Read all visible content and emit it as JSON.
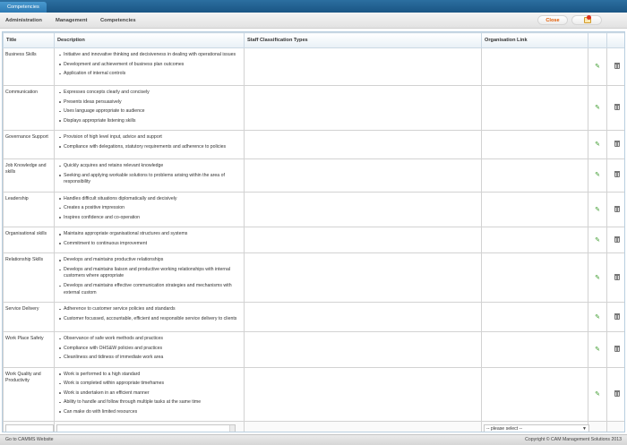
{
  "window": {
    "tab_label": "Competencies"
  },
  "menu": {
    "items": [
      "Administration",
      "Management",
      "Competencies"
    ],
    "close_label": "Close",
    "add_icon": "add-folder-icon"
  },
  "table": {
    "headers": [
      "Title",
      "Description",
      "Staff Classification Types",
      "Organisation Link"
    ],
    "rows": [
      {
        "title": "Business Skills",
        "items": [
          "Initiative and innovative thinking and decisiveness in dealing with operational issues",
          "Development and achievement of business plan outcomes",
          "Application of internal controls"
        ]
      },
      {
        "title": "Communication",
        "items": [
          "Expresses concepts clearly and concisely",
          "Presents ideas persuasively",
          "Uses language appropriate to audience",
          "Displays appropriate listening skills"
        ]
      },
      {
        "title": "Governance Support",
        "items": [
          "Provision of high level input, advice and support",
          "Compliance with delegations, statutory requirements and adherence to policies"
        ]
      },
      {
        "title": "Job Knowledge and skills",
        "items": [
          "Quickly acquires and retains relevant knowledge",
          "Seeking and applying workable solutions to problems arising within the area of responsibility"
        ]
      },
      {
        "title": "Leadership",
        "items": [
          "Handles difficult situations diplomatically and decisively",
          "Creates a positive impression",
          "Inspires confidence and co-operation"
        ]
      },
      {
        "title": "Organisational skills",
        "items": [
          "Maintains appropriate organisational structures and systems",
          "Commitment to continuous improvement"
        ]
      },
      {
        "title": "Relationship Skills",
        "items": [
          "Develops and maintains productive relationships",
          "Develops and maintains liaison and productive working relationships with internal customers where appropriate",
          "Develops and maintains effective communication strategies and mechanisms with external custom"
        ]
      },
      {
        "title": "Service Delivery",
        "items": [
          "Adherence to customer service policies and standards",
          "Customer focussed, accountable, efficient and responsible service delivery to clients"
        ]
      },
      {
        "title": "Work Place Safety",
        "items": [
          "Observance of safe work methods and practices",
          "Compliance with OHS&W policies and practices",
          "Cleanliness and tidiness of immediate work area"
        ]
      },
      {
        "title": "Work Quality and Productivity",
        "items": [
          "Work is performed to a high standard",
          "Work is completed within appropriate timeframes",
          "Work is undertaken in an efficient manner",
          "Ability to handle and follow through multiple tasks at the same time",
          "Can make do with limited resources"
        ]
      }
    ],
    "new_row": {
      "org_select_value": "-- please select --"
    }
  },
  "footer": {
    "link": "Go to CAMMS Website",
    "copyright": "Copyright © CAM Management Solutions 2013"
  },
  "colors": {
    "topbar": "#1a5584",
    "accent_close": "#e05a00",
    "edit_icon": "#3a9a2a"
  }
}
